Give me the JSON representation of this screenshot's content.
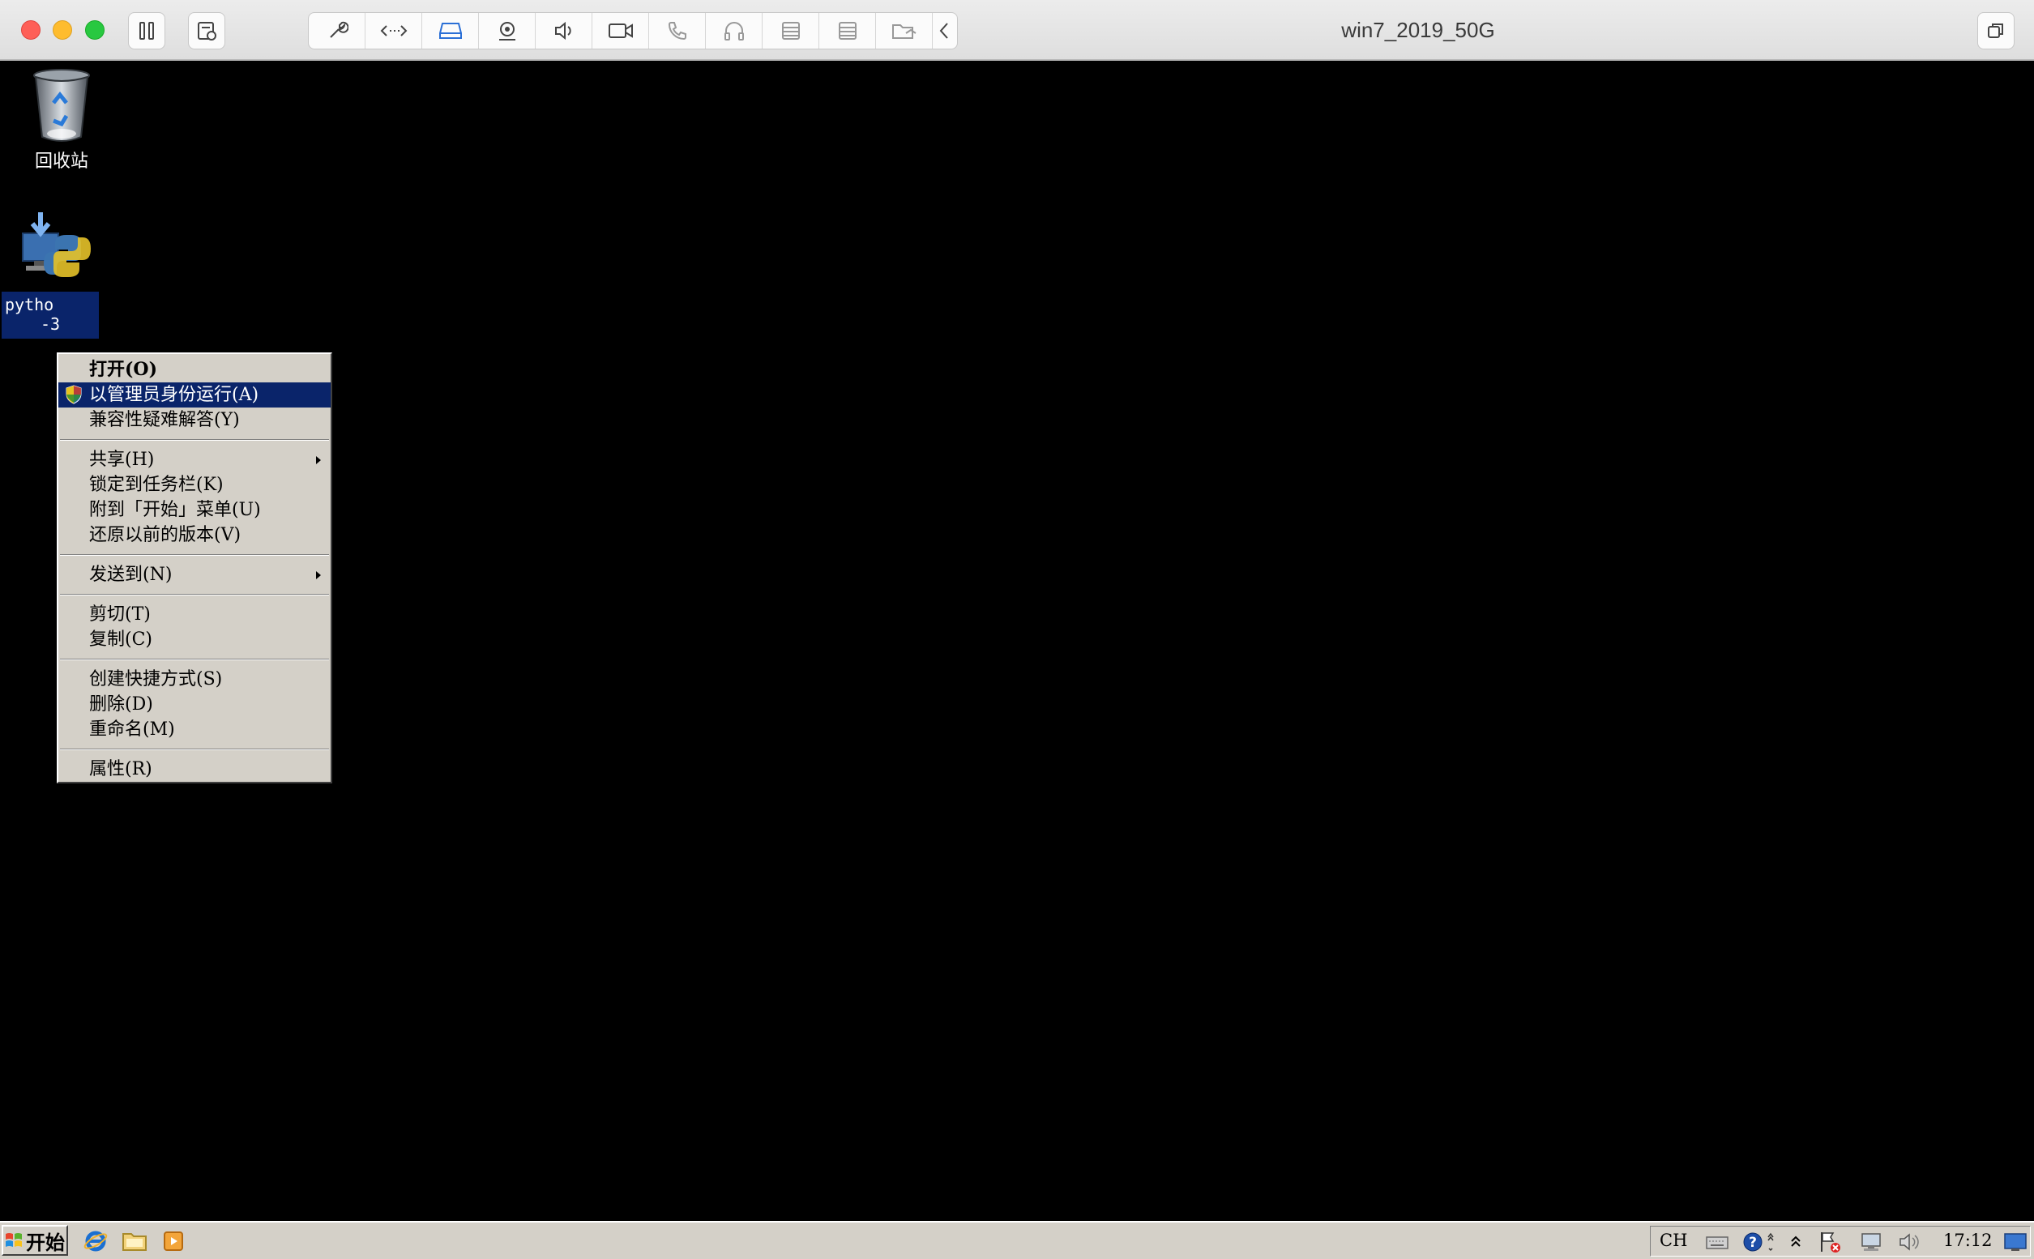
{
  "window": {
    "title": "win7_2019_50G",
    "toolbar_icons": [
      "pause-icon",
      "snapshot-icon",
      "settings-wrench-icon",
      "code-arrows-icon",
      "hard-drive-icon",
      "camera-device-icon",
      "speaker-icon",
      "video-camera-icon",
      "phone-icon",
      "headphones-icon",
      "serial-port-icon",
      "serial-port-2-icon",
      "shared-folder-icon",
      "collapse-chevron-icon",
      "restore-window-icon"
    ]
  },
  "desktop": {
    "recycle_bin_label": "回收站",
    "python_label_line1": "pytho",
    "python_label_line2": "-3"
  },
  "context_menu": {
    "items": [
      {
        "label": "打开(O)",
        "bold": true
      },
      {
        "label": "以管理员身份运行(A)",
        "highlighted": true,
        "icon": "uac-shield-icon"
      },
      {
        "label": "兼容性疑难解答(Y)"
      },
      {
        "separator": true
      },
      {
        "label": "共享(H)",
        "submenu": true
      },
      {
        "label": "锁定到任务栏(K)"
      },
      {
        "label": "附到「开始」菜单(U)"
      },
      {
        "label": "还原以前的版本(V)"
      },
      {
        "separator": true
      },
      {
        "label": "发送到(N)",
        "submenu": true
      },
      {
        "separator": true
      },
      {
        "label": "剪切(T)"
      },
      {
        "label": "复制(C)"
      },
      {
        "separator": true
      },
      {
        "label": "创建快捷方式(S)"
      },
      {
        "label": "删除(D)"
      },
      {
        "label": "重命名(M)"
      },
      {
        "separator": true
      },
      {
        "label": "属性(R)"
      }
    ]
  },
  "taskbar": {
    "start_label": "开始",
    "quick_launch": [
      "internet-explorer-icon",
      "explorer-folder-icon",
      "media-player-icon"
    ],
    "tray": {
      "language": "CH",
      "clock": "17:12"
    }
  },
  "colors": {
    "highlight": "#0a246a",
    "menu_bg": "#d4d0c8",
    "desktop_bg": "#000000"
  }
}
